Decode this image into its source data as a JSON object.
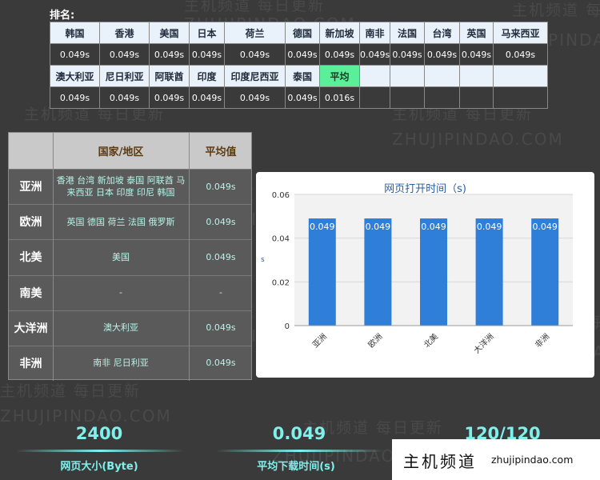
{
  "ranking": {
    "title": "排名:",
    "rows": [
      {
        "names": [
          "韩国",
          "香港",
          "美国",
          "日本",
          "荷兰",
          "德国",
          "新加坡",
          "南非",
          "法国",
          "台湾",
          "英国",
          "马来西亚"
        ],
        "times": [
          "0.049s",
          "0.049s",
          "0.049s",
          "0.049s",
          "0.049s",
          "0.049s",
          "0.049s",
          "0.049s",
          "0.049s",
          "0.049s",
          "0.049s",
          "0.049s"
        ]
      },
      {
        "names": [
          "澳大利亚",
          "尼日利亚",
          "阿联酋",
          "印度",
          "印度尼西亚",
          "泰国",
          "平均",
          "",
          "",
          "",
          "",
          ""
        ],
        "times": [
          "0.049s",
          "0.049s",
          "0.049s",
          "0.049s",
          "0.049s",
          "0.049s",
          "0.016s",
          "",
          "",
          "",
          "",
          ""
        ]
      }
    ],
    "highlight_color": "#5af09a"
  },
  "region_table": {
    "headers": [
      "国家/地区",
      "平均值"
    ],
    "rows": [
      {
        "region": "亚洲",
        "countries": "香港 台湾 新加坡 泰国 阿联酋 马来西亚 日本 印度 印尼 韩国",
        "avg": "0.049s"
      },
      {
        "region": "欧洲",
        "countries": "英国 德国 荷兰 法国 俄罗斯",
        "avg": "0.049s"
      },
      {
        "region": "北美",
        "countries": "美国",
        "avg": "0.049s"
      },
      {
        "region": "南美",
        "countries": "-",
        "avg": "-"
      },
      {
        "region": "大洋洲",
        "countries": "澳大利亚",
        "avg": "0.049s"
      },
      {
        "region": "非洲",
        "countries": "南非 尼日利亚",
        "avg": "0.049s"
      }
    ]
  },
  "chart_data": {
    "type": "bar",
    "title": "网页打开时间（s)",
    "ylabel": "s",
    "categories": [
      "亚洲",
      "欧洲",
      "北美",
      "大洋洲",
      "非洲"
    ],
    "values": [
      0.049,
      0.049,
      0.049,
      0.049,
      0.049
    ],
    "value_labels": [
      "0.049",
      "0.049",
      "0.049",
      "0.049",
      "0.049"
    ],
    "yticks": [
      "0",
      "0.02",
      "0.04",
      "0.06"
    ],
    "ylim": [
      0,
      0.06
    ],
    "grid": true,
    "bar_color": "#2f7fd8"
  },
  "stats": [
    {
      "value": "2400",
      "label": "网页大小(Byte)"
    },
    {
      "value": "0.049",
      "label": "平均下载时间(s)"
    },
    {
      "value": "120/120",
      "label": ""
    }
  ],
  "watermark": {
    "cn": "主机频道 每日更新",
    "en": "ZHUJIPINDAO.COM"
  },
  "logo": {
    "cn": "主机频道",
    "url": "zhujipindao.com"
  }
}
